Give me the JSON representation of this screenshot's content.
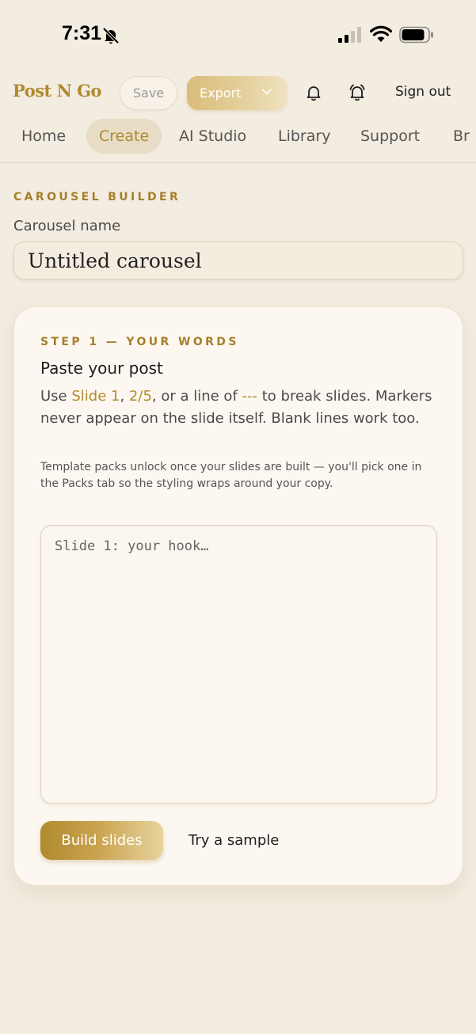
{
  "status": {
    "time": "7:31"
  },
  "header": {
    "brand": "Post N Go",
    "save_label": "Save",
    "export_label": "Export",
    "signout_label": "Sign out"
  },
  "tabs": [
    {
      "label": "Home"
    },
    {
      "label": "Create",
      "active": true
    },
    {
      "label": "AI Studio"
    },
    {
      "label": "Library"
    },
    {
      "label": "Support"
    },
    {
      "label": "Br"
    }
  ],
  "builder": {
    "eyebrow": "CAROUSEL BUILDER",
    "name_label": "Carousel name",
    "name_value": "Untitled carousel"
  },
  "step": {
    "eyebrow": "STEP 1 — YOUR WORDS",
    "title": "Paste your post",
    "desc_1": "Use ",
    "desc_hl_1": "Slide 1",
    "desc_2": ", ",
    "desc_hl_2": "2/5",
    "desc_3": ", or a line of ",
    "desc_hl_3": "---",
    "desc_4": " to break slides. Markers never appear on the slide itself. Blank lines work too.",
    "note": "Template packs unlock once your slides are built — you'll pick one in the Packs tab so the styling wraps around your copy.",
    "textarea_placeholder": "Slide 1: your hook…",
    "build_label": "Build slides",
    "sample_label": "Try a sample"
  },
  "colors": {
    "accent": "#b08a2e",
    "background": "#f3ece0",
    "card": "#fcf8f1"
  },
  "icons": {
    "silent": "bell-slash-icon",
    "signal": "cellular-signal-icon",
    "wifi": "wifi-icon",
    "battery": "battery-icon",
    "notifications": "bell-icon",
    "alerts": "bell-ringing-icon",
    "export_menu": "chevron-down-icon"
  }
}
